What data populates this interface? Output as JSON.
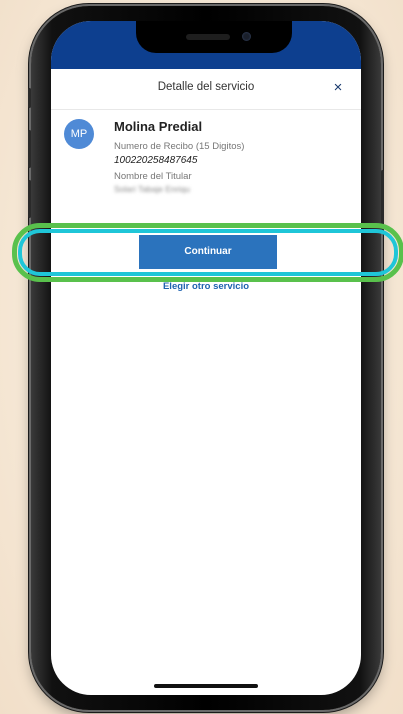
{
  "header": {
    "title": "Detalle del servicio",
    "close_icon": "×"
  },
  "service": {
    "avatar_initials": "MP",
    "name": "Molina Predial",
    "receipt_label": "Numero de Recibo (15 Digitos)",
    "receipt_number": "100220258487645",
    "holder_label": "Nombre del Titular",
    "holder_name": "Solari Tabaje Enriqu"
  },
  "actions": {
    "continue_label": "Continuar",
    "other_service_label": "Elegir otro servicio"
  },
  "colors": {
    "status_bar": "#0d3f8f",
    "primary_button": "#2b73bd",
    "link": "#1f63b0",
    "avatar": "#4f8ad6",
    "highlight_outer": "#59c14c",
    "highlight_inner": "#1fc6d8",
    "background": "#f6e8d6"
  }
}
